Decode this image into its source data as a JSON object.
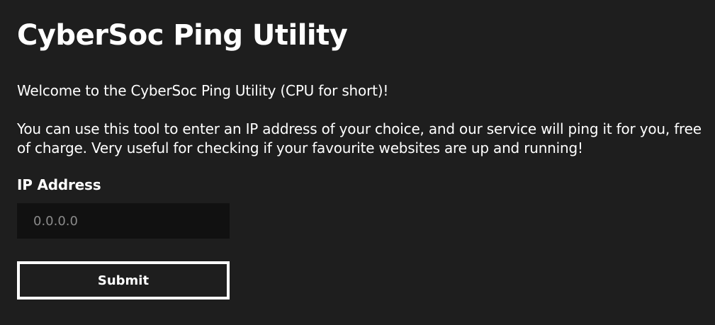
{
  "header": {
    "title": "CyberSoc Ping Utility"
  },
  "intro": {
    "welcome": "Welcome to the CyberSoc Ping Utility (CPU for short)!",
    "description": "You can use this tool to enter an IP address of your choice, and our service will ping it for you, free of charge. Very useful for checking if your favourite websites are up and running!"
  },
  "form": {
    "ip_label": "IP Address",
    "ip_placeholder": "0.0.0.0",
    "ip_value": "",
    "submit_label": "Submit"
  },
  "colors": {
    "background": "#1e1e1e",
    "input_background": "#111111",
    "text": "#ffffff",
    "placeholder": "#8a8a8a"
  }
}
